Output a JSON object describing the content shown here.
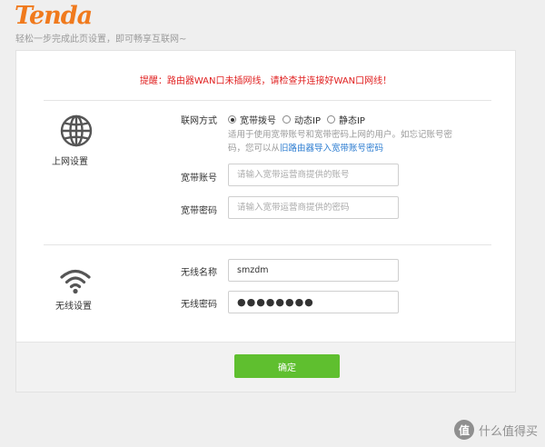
{
  "header": {
    "logo_text": "Tenda",
    "tagline": "轻松一步完成此页设置，即可畅享互联网~"
  },
  "alert": "提醒：路由器WAN口未插网线，请检查并连接好WAN口网线！",
  "internet": {
    "section_label": "上网设置",
    "icon": "globe-icon",
    "connection_type_label": "联网方式",
    "options": [
      {
        "label": "宽带拨号",
        "checked": true
      },
      {
        "label": "动态IP",
        "checked": false
      },
      {
        "label": "静态IP",
        "checked": false
      }
    ],
    "hint_text": "适用于使用宽带账号和宽带密码上网的用户。如忘记账号密码，您可以从",
    "hint_link": "旧路由器导入宽带账号密码",
    "account_label": "宽带账号",
    "account_placeholder": "请输入宽带运营商提供的账号",
    "password_label": "宽带密码",
    "password_placeholder": "请输入宽带运营商提供的密码"
  },
  "wireless": {
    "section_label": "无线设置",
    "icon": "wifi-icon",
    "name_label": "无线名称",
    "name_value": "smzdm",
    "password_label": "无线密码",
    "password_value": "●●●●●●●●"
  },
  "footer": {
    "confirm_label": "确定"
  },
  "watermark": {
    "badge": "值",
    "text": "什么值得买"
  },
  "colors": {
    "brand": "#f07a1d",
    "alert": "#e02020",
    "link": "#2a7bd0",
    "confirm": "#5fbf2f"
  }
}
